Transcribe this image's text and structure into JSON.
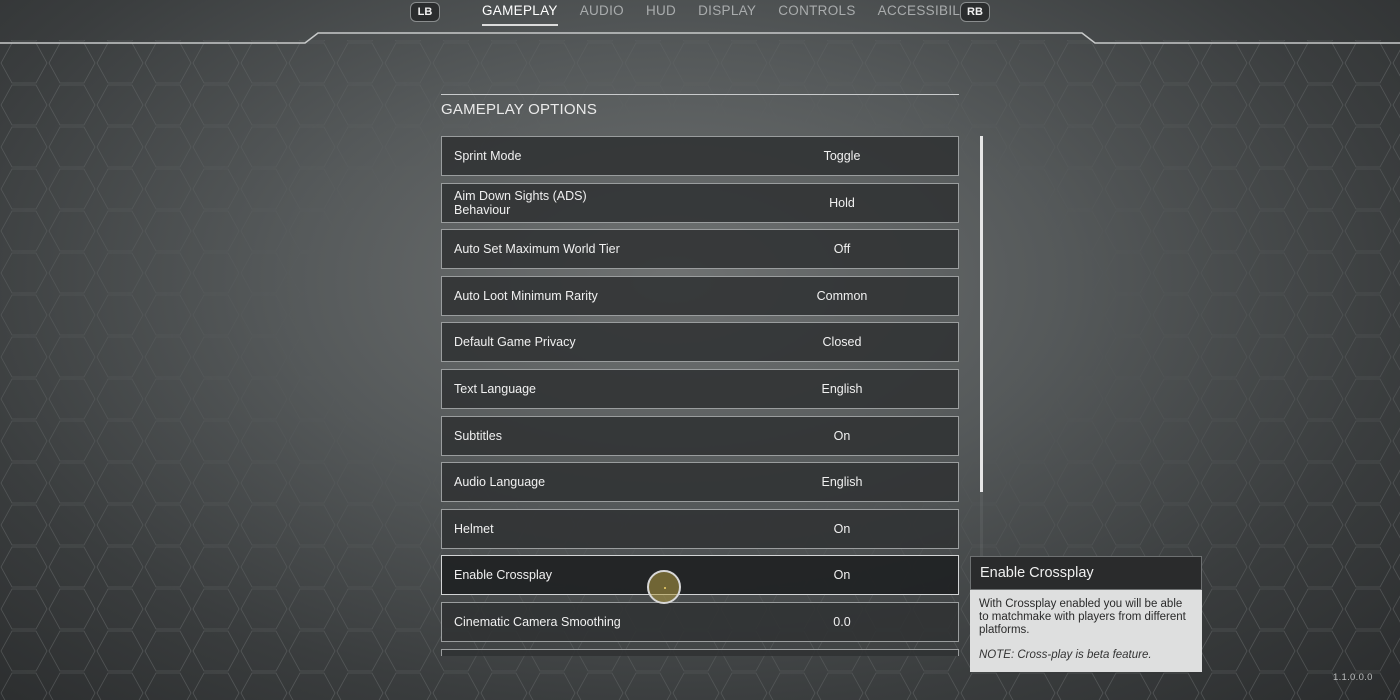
{
  "nav": {
    "left_bumper": "LB",
    "right_bumper": "RB",
    "tabs": [
      {
        "label": "GAMEPLAY",
        "active": true
      },
      {
        "label": "AUDIO",
        "active": false
      },
      {
        "label": "HUD",
        "active": false
      },
      {
        "label": "DISPLAY",
        "active": false
      },
      {
        "label": "CONTROLS",
        "active": false
      },
      {
        "label": "ACCESSIBILITY",
        "active": false
      }
    ]
  },
  "panel": {
    "title": "GAMEPLAY OPTIONS",
    "options": [
      {
        "label": "Sprint Mode",
        "value": "Toggle"
      },
      {
        "label": "Aim Down Sights (ADS) Behaviour",
        "value": "Hold"
      },
      {
        "label": "Auto Set Maximum World Tier",
        "value": "Off"
      },
      {
        "label": "Auto Loot Minimum Rarity",
        "value": "Common"
      },
      {
        "label": "Default Game Privacy",
        "value": "Closed"
      },
      {
        "label": "Text Language",
        "value": "English"
      },
      {
        "label": "Subtitles",
        "value": "On"
      },
      {
        "label": "Audio Language",
        "value": "English"
      },
      {
        "label": "Helmet",
        "value": "On"
      },
      {
        "label": "Enable Crossplay",
        "value": "On"
      },
      {
        "label": "Cinematic Camera Smoothing",
        "value": "0.0"
      }
    ],
    "selected_index": 9
  },
  "tooltip": {
    "title": "Enable Crossplay",
    "description": "With Crossplay enabled you will be able to matchmake with players from different platforms.",
    "note": "NOTE: Cross-play is beta feature."
  },
  "version": "1.1.0.0.0",
  "colors": {
    "background": "#55595a",
    "row_background": "#303233",
    "row_border": "#9a9d9e",
    "tooltip_body": "#dedfdf",
    "cursor_fill": "#b09a42"
  }
}
